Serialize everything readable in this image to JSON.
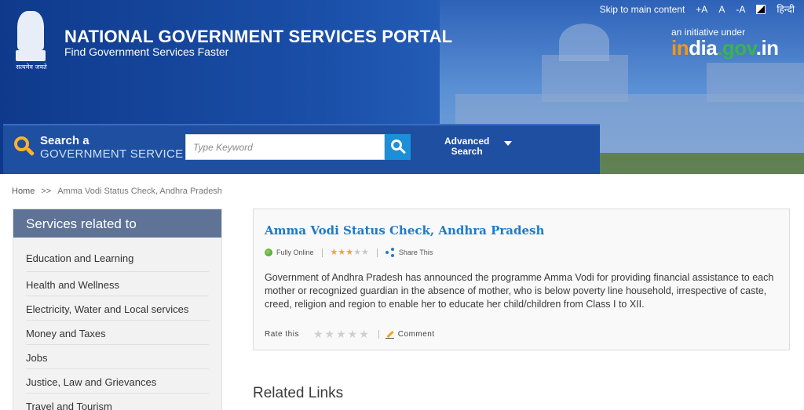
{
  "header": {
    "title": "NATIONAL GOVERNMENT SERVICES PORTAL",
    "subtitle": "Find Government Services Faster",
    "emblem_motto": "सत्यमेव जयते",
    "initiative_label": "an initiative under",
    "indiagov_parts": [
      "in",
      "dia",
      ".gov",
      ".in"
    ]
  },
  "topbar": {
    "skip": "Skip to main content",
    "font_increase": "+A",
    "font_normal": "A",
    "font_decrease": "-A",
    "language": "हिन्दी"
  },
  "search": {
    "line1": "Search a",
    "line2": "GOVERNMENT SERVICE",
    "placeholder": "Type Keyword",
    "advanced_line1": "Advanced",
    "advanced_line2": "Search"
  },
  "breadcrumb": {
    "home": "Home",
    "separator": ">>",
    "current": "Amma Vodi Status Check, Andhra Pradesh"
  },
  "sidebar": {
    "heading": "Services related to",
    "items": [
      "Education and Learning",
      "Health and Wellness",
      "Electricity, Water and Local services",
      "Money and Taxes",
      "Jobs",
      "Justice, Law and Grievances",
      "Travel and Tourism"
    ]
  },
  "service": {
    "title": "Amma Vodi Status Check, Andhra Pradesh",
    "status": "Fully Online",
    "rating": 3,
    "rating_max": 5,
    "share": "Share This",
    "description": "Government of Andhra Pradesh has announced the programme Amma Vodi for providing financial assistance to each mother or recognized guardian in the absence of mother, who is below poverty line household, irrespective of caste, creed, religion and region to enable her to educate her child/children from Class I to XII.",
    "rate_label": "Rate this",
    "comment": "Comment"
  },
  "related": {
    "heading": "Related Links"
  },
  "colors": {
    "header_blue": "#1a4fa8",
    "search_bar": "#1e4fa0",
    "sidebar_head": "#5e7396",
    "link_blue": "#1f7ac7",
    "star_on": "#f5a623",
    "accent_yellow": "#f7b42c"
  }
}
